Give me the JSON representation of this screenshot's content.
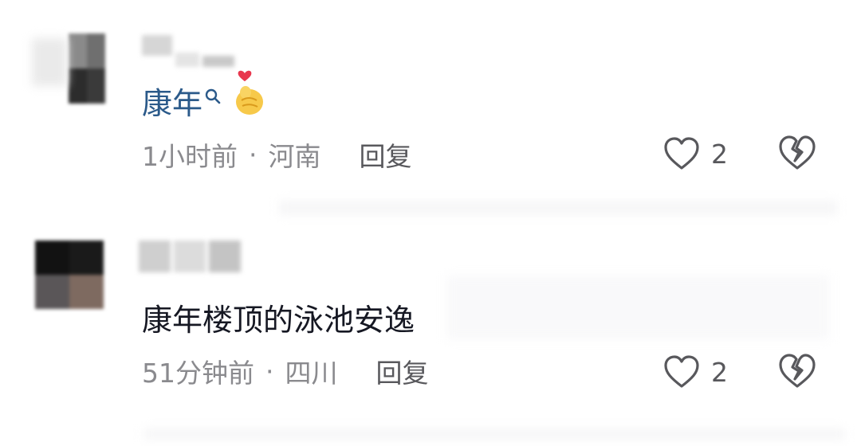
{
  "comments": [
    {
      "text_link": "康年",
      "time": "1小时前",
      "location": "河南",
      "reply_label": "回复",
      "like_count": "2"
    },
    {
      "text": "康年楼顶的泳池安逸",
      "time": "51分钟前",
      "location": "四川",
      "reply_label": "回复",
      "like_count": "2"
    }
  ],
  "separator": "·",
  "icons": {
    "search": "search-icon",
    "emoji": "finger-heart-emoji-icon",
    "like": "heart-outline-icon",
    "dislike": "broken-heart-icon"
  },
  "colors": {
    "link": "#2b5a8a",
    "text": "#161823",
    "meta": "#8a8a8e",
    "action": "#58585c"
  }
}
